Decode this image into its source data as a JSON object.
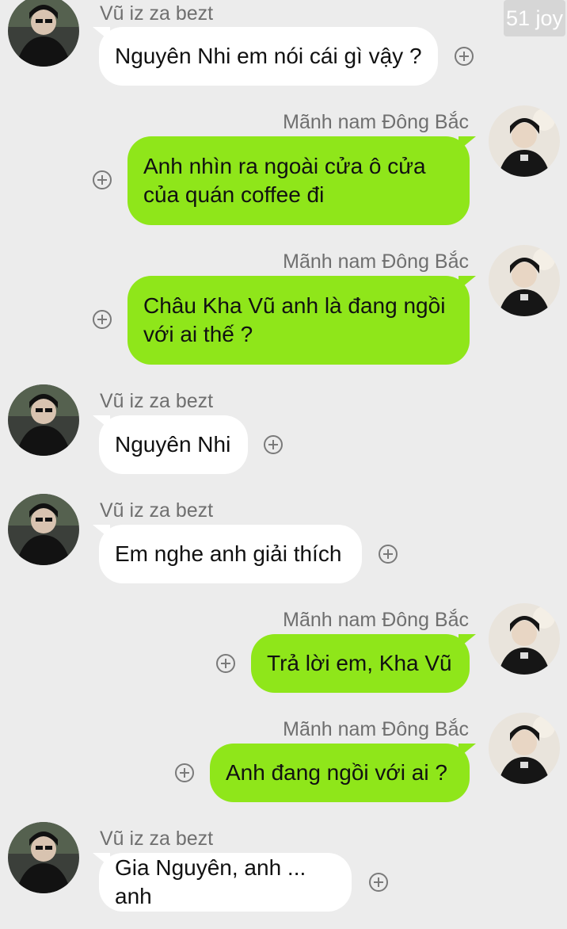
{
  "watermark": "51 joy",
  "contacts": {
    "them": {
      "name": "Vũ iz za bezt",
      "avatar": "avatar-dark-portrait"
    },
    "me": {
      "name": "Mãnh nam Đông Bắc",
      "avatar": "avatar-light-portrait"
    }
  },
  "messages": [
    {
      "side": "in",
      "sender": "Vũ iz za bezt",
      "text": "Nguyên Nhi em nói cái gì vậy ?"
    },
    {
      "side": "out",
      "sender": "Mãnh nam Đông Bắc",
      "text": "Anh nhìn ra ngoài cửa ô cửa\ncủa quán coffee đi"
    },
    {
      "side": "out",
      "sender": "Mãnh nam Đông Bắc",
      "text": "Châu Kha Vũ anh là đang ngồi\nvới ai thế ?"
    },
    {
      "side": "in",
      "sender": "Vũ iz za bezt",
      "text": "Nguyên Nhi"
    },
    {
      "side": "in",
      "sender": "Vũ iz za bezt",
      "text": "Em nghe anh giải thích"
    },
    {
      "side": "out",
      "sender": "Mãnh nam Đông Bắc",
      "text": "Trả lời em, Kha Vũ"
    },
    {
      "side": "out",
      "sender": "Mãnh nam Đông Bắc",
      "text": "Anh đang ngồi với ai ?"
    },
    {
      "side": "in",
      "sender": "Vũ iz za bezt",
      "text": "Gia Nguyên, anh ... anh"
    }
  ],
  "colors": {
    "background": "#ececec",
    "bubble_in": "#ffffff",
    "bubble_out": "#8fe61a",
    "name_text": "#6f6f6f"
  }
}
